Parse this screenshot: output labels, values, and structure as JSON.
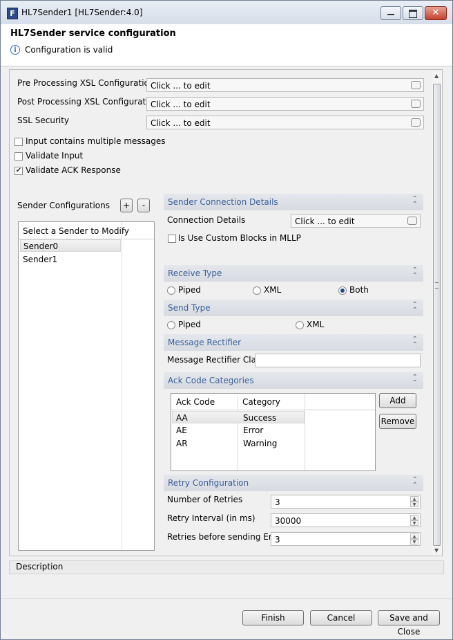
{
  "window": {
    "title": "HL7Sender1 [HL7Sender:4.0]",
    "app_icon": "F"
  },
  "header": {
    "title": "HL7Sender service configuration",
    "status": "Configuration is valid"
  },
  "top_fields": [
    {
      "label": "Pre Processing XSL Configuration",
      "value": "Click ... to edit"
    },
    {
      "label": "Post Processing XSL Configuration",
      "value": "Click ... to edit"
    },
    {
      "label": "SSL Security",
      "value": "Click ... to edit"
    }
  ],
  "options": [
    {
      "label": "Input contains multiple messages",
      "checked": false
    },
    {
      "label": "Validate Input",
      "checked": false
    },
    {
      "label": "Validate ACK Response",
      "checked": true
    }
  ],
  "sender_configurations": {
    "label": "Sender Configurations",
    "add": "+",
    "remove": "-",
    "column": "Select a Sender to Modify",
    "rows": [
      "Sender0",
      "Sender1"
    ]
  },
  "connection": {
    "header": "Sender Connection Details",
    "details_label": "Connection Details",
    "details_value": "Click ... to edit",
    "custom_blocks_label": "Is Use Custom Blocks in MLLP"
  },
  "receive_type": {
    "header": "Receive Type",
    "options": [
      "Piped",
      "XML",
      "Both"
    ],
    "selected": "Both"
  },
  "send_type": {
    "header": "Send Type",
    "options": [
      "Piped",
      "XML"
    ],
    "selected": ""
  },
  "rectifier": {
    "header": "Message Rectifier",
    "class_label": "Message Rectifier Class",
    "class_value": ""
  },
  "ack": {
    "header": "Ack Code Categories",
    "columns": [
      "Ack Code",
      "Category"
    ],
    "rows": [
      [
        "AA",
        "Success"
      ],
      [
        "AE",
        "Error"
      ],
      [
        "AR",
        "Warning"
      ]
    ],
    "add": "Add",
    "remove": "Remove"
  },
  "retry": {
    "header": "Retry Configuration",
    "fields": [
      {
        "label": "Number of Retries",
        "value": "3"
      },
      {
        "label": "Retry Interval (in ms)",
        "value": "30000"
      },
      {
        "label": "Retries before sending Error",
        "value": "3"
      }
    ]
  },
  "description": {
    "label": "Description"
  },
  "footer": {
    "finish": "Finish",
    "cancel": "Cancel",
    "save_close": "Save and Close"
  }
}
